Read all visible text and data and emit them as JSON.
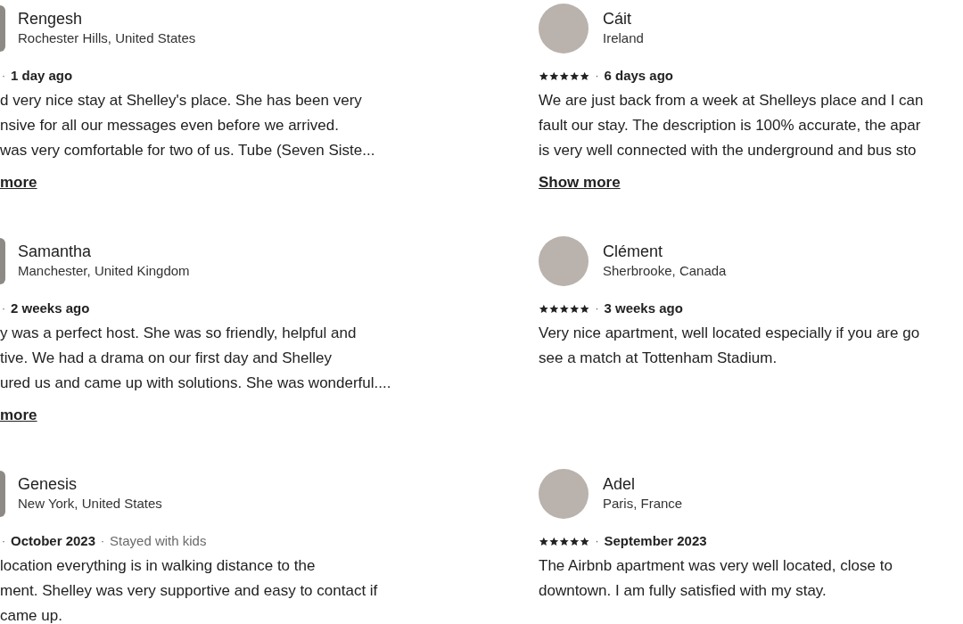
{
  "reviews": [
    {
      "kind": "cut",
      "name": "Rengesh",
      "location": "Rochester Hills, United States",
      "separator": "·",
      "date": "1 day ago",
      "body": [
        "d very nice stay at Shelley's place. She has been very",
        "nsive for all our messages even before we arrived.",
        "was very comfortable for two of us. Tube (Seven Siste..."
      ],
      "link": "more"
    },
    {
      "kind": "full",
      "name": "Cáit",
      "location": "Ireland",
      "stars": 5,
      "separator": "·",
      "date": "6 days ago",
      "body": [
        "We are just back from a week at Shelleys place and I can",
        "fault our stay. The description is 100% accurate, the apar",
        "is very well connected with the underground and bus sto"
      ],
      "link": "Show more"
    },
    {
      "kind": "cut",
      "name": "Samantha",
      "location": "Manchester, United Kingdom",
      "separator": "·",
      "date": "2 weeks ago",
      "body": [
        "y was a perfect host. She was so friendly, helpful and",
        "tive. We had a drama on our first day and Shelley",
        "ured us and came up with solutions. She was wonderful...."
      ],
      "link": "more"
    },
    {
      "kind": "full",
      "name": "Clément",
      "location": "Sherbrooke, Canada",
      "stars": 5,
      "separator": "·",
      "date": "3 weeks ago",
      "body": [
        "Very nice apartment, well located especially if you are go",
        "see a match at Tottenham Stadium."
      ]
    },
    {
      "kind": "cut",
      "name": "Genesis",
      "location": "New York, United States",
      "separator": "·",
      "date": "October 2023",
      "trip_separator": "·",
      "trip": "Stayed with kids",
      "body": [
        "location everything is in walking distance to the",
        "ment. Shelley was very supportive and easy to contact if",
        "came up."
      ]
    },
    {
      "kind": "full",
      "name": "Adel",
      "location": "Paris, France",
      "stars": 5,
      "separator": "·",
      "date": "September 2023",
      "body": [
        "The Airbnb apartment was very well located, close to",
        "downtown. I am fully satisfied with my stay."
      ]
    }
  ]
}
